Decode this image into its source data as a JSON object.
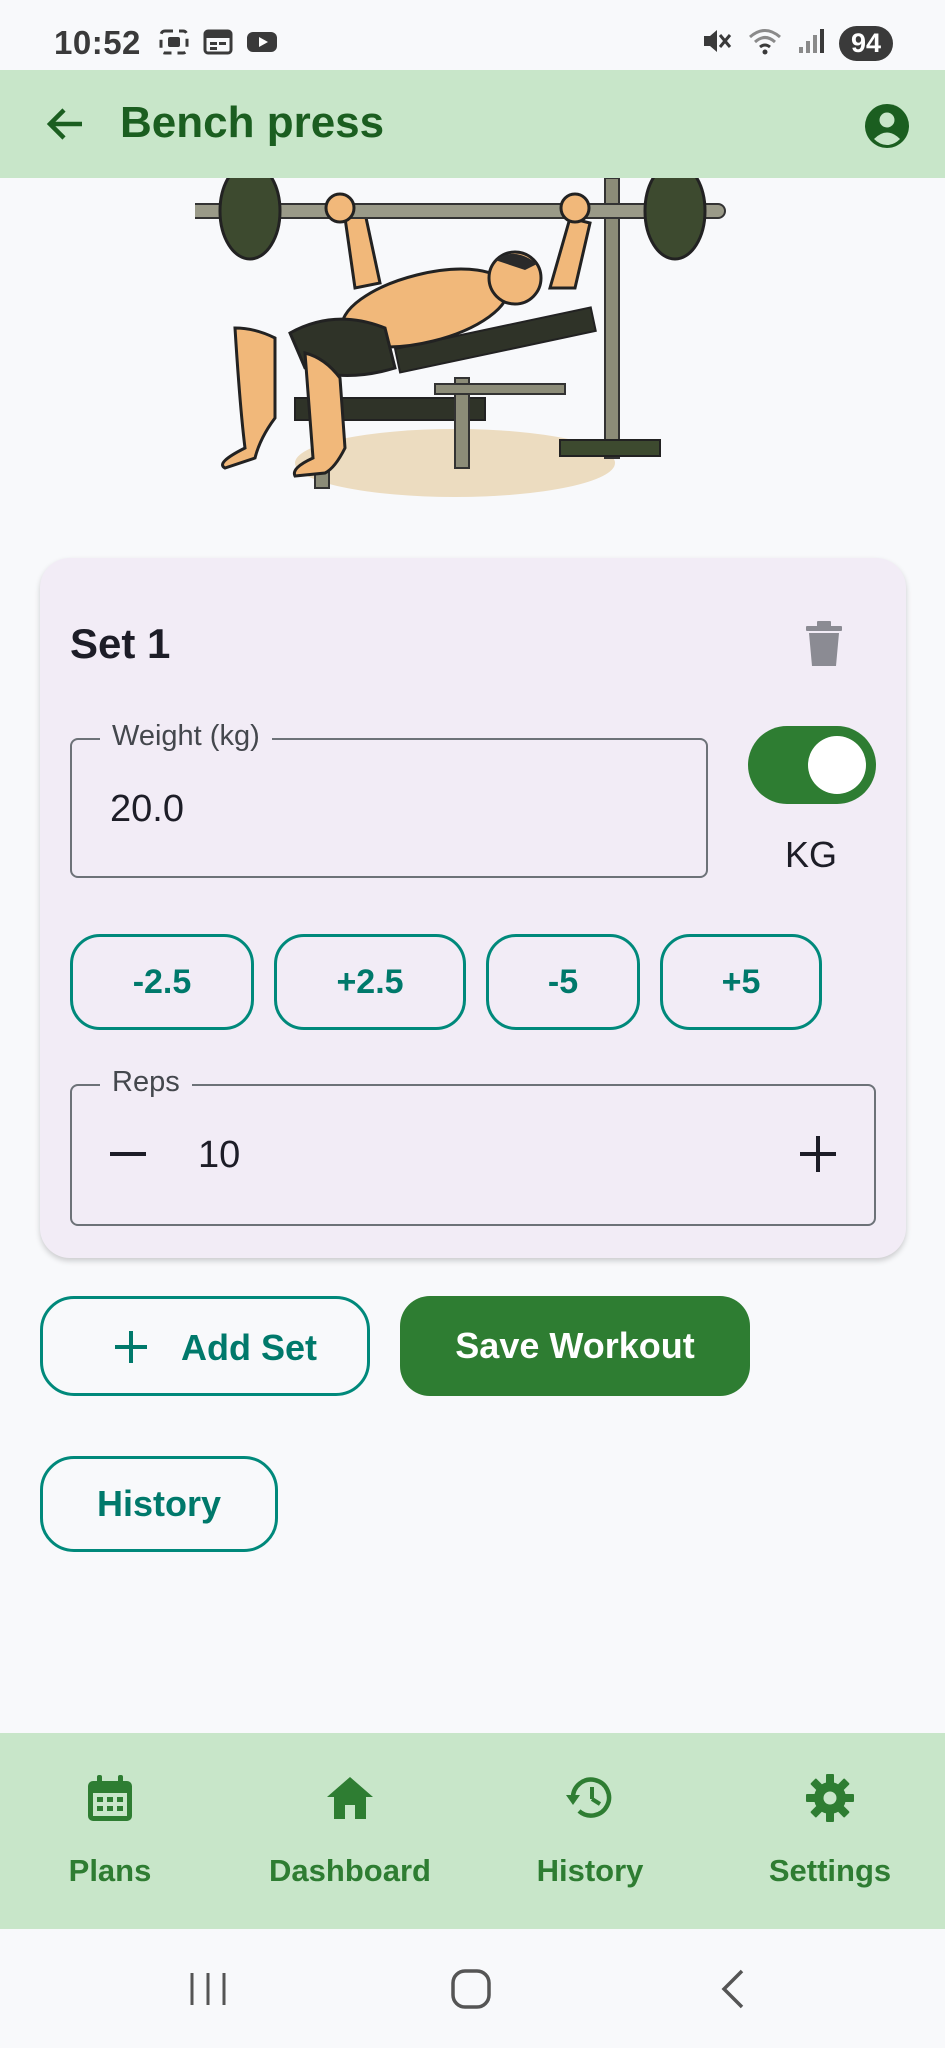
{
  "status_bar": {
    "time": "10:52",
    "battery": "94"
  },
  "app_bar": {
    "title": "Bench press"
  },
  "set_card": {
    "title": "Set 1",
    "weight_label": "Weight (kg)",
    "weight_value": "20.0",
    "unit_label": "KG",
    "unit_toggle_on": true,
    "increment_buttons": [
      "-2.5",
      "+2.5",
      "-5",
      "+5"
    ],
    "reps_label": "Reps",
    "reps_value": "10"
  },
  "actions": {
    "add_set": "Add Set",
    "save_workout": "Save Workout",
    "history": "History"
  },
  "bottom_nav": {
    "items": [
      {
        "label": "Plans",
        "icon": "calendar-icon"
      },
      {
        "label": "Dashboard",
        "icon": "home-icon"
      },
      {
        "label": "History",
        "icon": "history-icon"
      },
      {
        "label": "Settings",
        "icon": "gear-icon"
      }
    ]
  },
  "colors": {
    "app_bar_bg": "#c8e6c9",
    "primary": "#2e7d32",
    "outline_accent": "#00897b",
    "card_bg": "#f2ecf6"
  }
}
